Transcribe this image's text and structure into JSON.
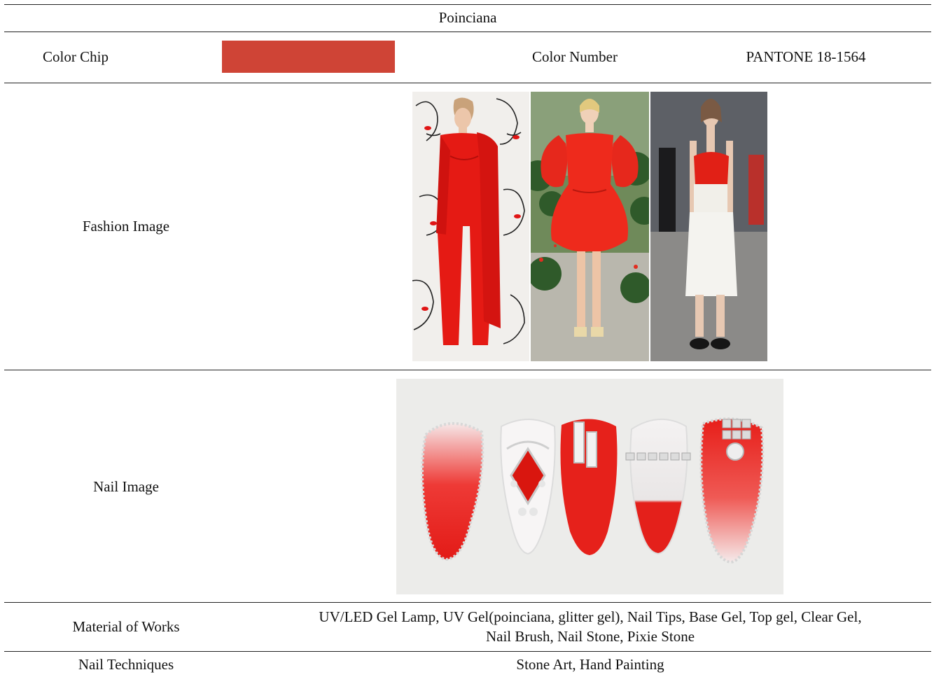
{
  "title": "Poinciana",
  "color_chip": {
    "label": "Color Chip",
    "color": "#cf4436",
    "number_label": "Color Number",
    "number_value": "PANTONE 18-1564"
  },
  "fashion": {
    "label": "Fashion Image",
    "images": [
      "red-pantsuit-photo",
      "red-ruffle-dress-photo",
      "red-bustier-white-skirt-photo"
    ]
  },
  "nail": {
    "label": "Nail Image",
    "image": "red-stone-nail-art-photo"
  },
  "material": {
    "label": "Material of Works",
    "line1": "UV/LED Gel Lamp, UV Gel(poinciana, glitter gel), Nail Tips, Base Gel, Top gel, Clear Gel,",
    "line2": "Nail Brush, Nail Stone, Pixie Stone"
  },
  "technique": {
    "label": "Nail Techniques",
    "value": "Stone Art, Hand Painting"
  }
}
